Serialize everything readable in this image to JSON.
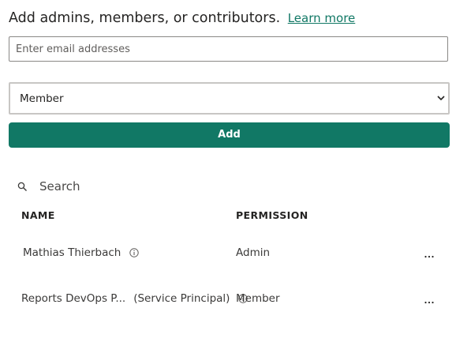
{
  "header": {
    "title": "Add admins, members, or contributors.",
    "learn_more": "Learn more"
  },
  "email_input": {
    "placeholder": "Enter email addresses",
    "value": ""
  },
  "role_select": {
    "selected": "Member"
  },
  "add_button": {
    "label": "Add"
  },
  "search": {
    "placeholder": "Search",
    "icon": "search-icon"
  },
  "table": {
    "columns": [
      "NAME",
      "PERMISSION"
    ],
    "rows": [
      {
        "name": "Mathias Thierbach",
        "tag": "",
        "permission": "Admin"
      },
      {
        "name": "Reports DevOps P...",
        "tag": "(Service Principal)",
        "permission": "Member"
      }
    ]
  },
  "colors": {
    "accent": "#117865",
    "text": "#252423",
    "border": "#8a8886"
  }
}
